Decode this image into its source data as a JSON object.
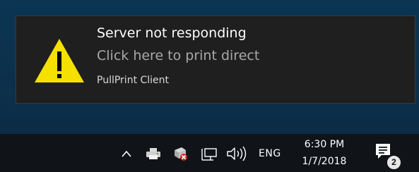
{
  "notification": {
    "title": "Server not responding",
    "body": "Click here to print direct",
    "app_name": "PullPrint Client",
    "icon": "warning-icon",
    "icon_color": "#f5e000"
  },
  "taskbar": {
    "tray_icons": [
      "chevron-up-icon",
      "printer-icon",
      "printer-error-icon",
      "network-icon",
      "volume-icon"
    ],
    "language": "ENG",
    "time": "6:30 PM",
    "date": "1/7/2018",
    "action_center": {
      "icon": "action-center-icon",
      "badge_count": "2"
    }
  }
}
